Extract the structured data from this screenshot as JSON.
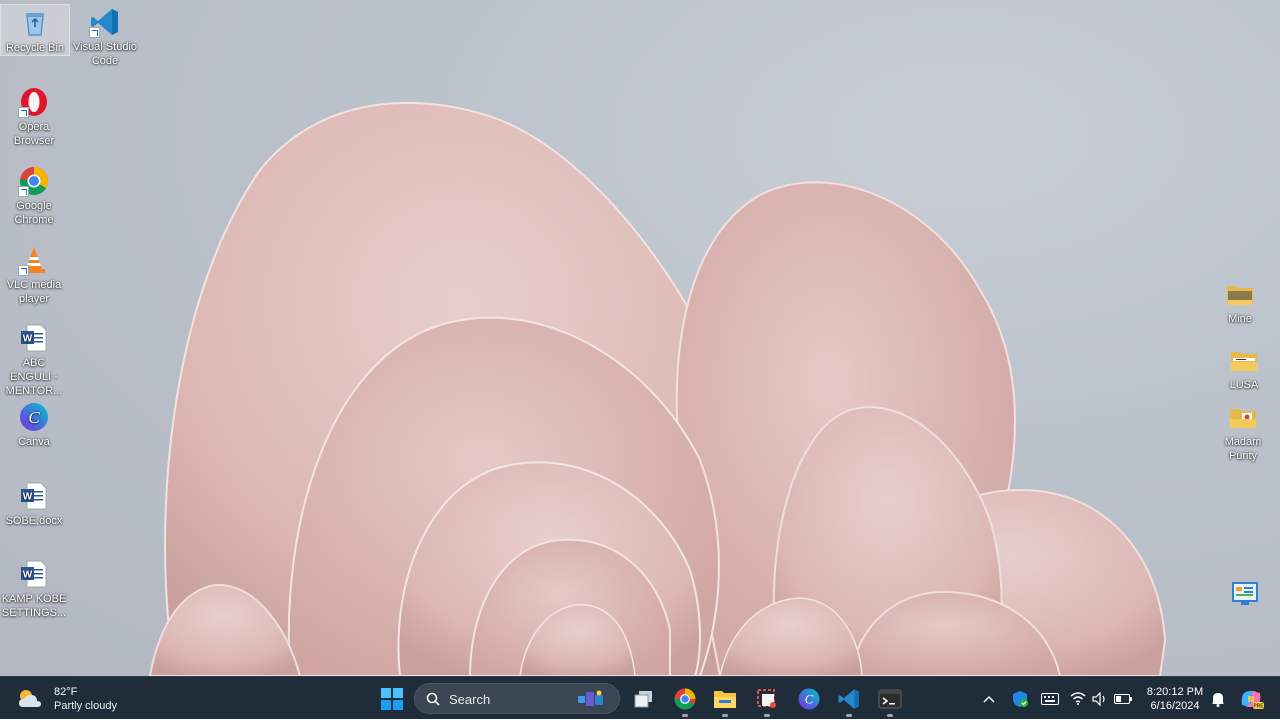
{
  "desktop": {
    "icons_left": [
      {
        "label": "Recycle Bin",
        "icon": "recycle-bin-icon"
      },
      {
        "label": "Visual Studio Code",
        "icon": "vscode-icon"
      },
      {
        "label": "Opera Browser",
        "icon": "opera-icon"
      },
      {
        "label": "Google Chrome",
        "icon": "chrome-icon"
      },
      {
        "label": "VLC media player",
        "icon": "vlc-icon"
      },
      {
        "label": "ABC ENGULI - MENTOR...",
        "icon": "word-document-icon"
      },
      {
        "label": "Canva",
        "icon": "canva-icon"
      },
      {
        "label": "SOBE.docx",
        "icon": "word-document-icon"
      },
      {
        "label": "KAMP KOBE SETTINGS...",
        "icon": "word-document-icon"
      }
    ],
    "icons_right": [
      {
        "label": "Mine",
        "icon": "folder-icon"
      },
      {
        "label": "LUSA",
        "icon": "folder-icon"
      },
      {
        "label": "Madam Purity",
        "icon": "folder-icon"
      },
      {
        "label": "",
        "icon": "control-panel-icon"
      }
    ]
  },
  "taskbar": {
    "weather": {
      "temp": "82°F",
      "desc": "Partly cloudy",
      "icon": "partly-cloudy-icon"
    },
    "search": {
      "label": "Search"
    },
    "apps": [
      "windows-start-icon",
      "task-view-icon",
      "chrome-icon",
      "file-explorer-icon",
      "snipping-tool-icon",
      "canva-icon",
      "vscode-icon",
      "terminal-icon"
    ],
    "tray": [
      "chevron-up-icon",
      "windows-security-icon",
      "keyboard-icon",
      "wifi-icon",
      "volume-icon",
      "battery-icon"
    ],
    "clock": {
      "time": "8:20:12 PM",
      "date": "6/16/2024"
    },
    "notification_icon": "bell-icon",
    "copilot_icon": "copilot-icon"
  },
  "colors": {
    "taskbar_bg": "#1f2c3a",
    "wallpaper_petal": "#e3c2c0",
    "desktop_bg": "#bcc2cb"
  }
}
